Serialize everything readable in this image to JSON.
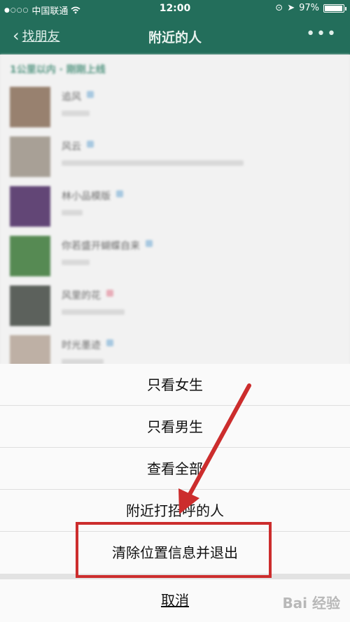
{
  "status_bar": {
    "carrier": "中国联通",
    "time": "12:00",
    "battery": "97%",
    "battery_level": 0.97
  },
  "nav": {
    "back_label": "找朋友",
    "title": "附近的人"
  },
  "list": {
    "section_header": "1公里以内 · 刚刚上线",
    "people": [
      {
        "name": "追风",
        "gender": "male"
      },
      {
        "name": "风云",
        "gender": "male"
      },
      {
        "name": "林小品模版",
        "gender": "male"
      },
      {
        "name": "你若盛开蝴蝶自来",
        "gender": "male"
      },
      {
        "name": "风里的花",
        "gender": "female"
      },
      {
        "name": "时光墨迹",
        "gender": "male"
      }
    ]
  },
  "action_sheet": {
    "items": [
      "只看女生",
      "只看男生",
      "查看全部",
      "附近打招呼的人",
      "清除位置信息并退出"
    ],
    "cancel": "取消"
  },
  "watermark": "Bai 经验",
  "colors": {
    "brand_green": "#236e5b",
    "highlight_red": "#cc2d2d"
  }
}
